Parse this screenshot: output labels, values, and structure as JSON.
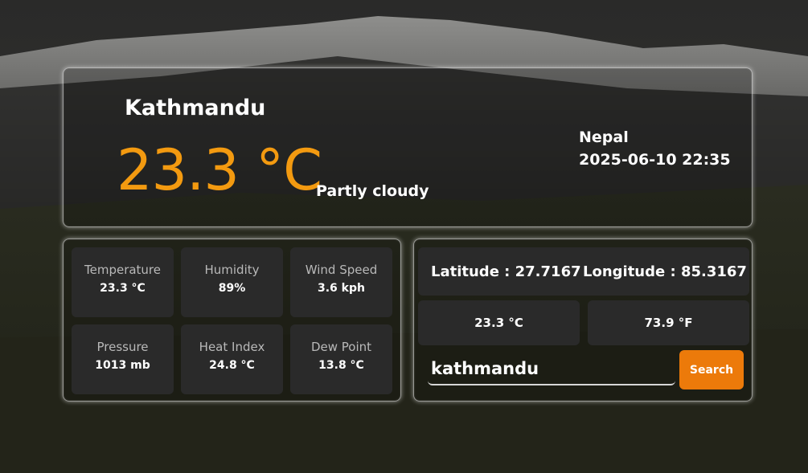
{
  "weather": {
    "city": "Kathmandu",
    "temperature": "23.3 °C",
    "condition": "Partly cloudy",
    "country": "Nepal",
    "datetime": "2025-06-10 22:35"
  },
  "stats": [
    {
      "label": "Temperature",
      "value": "23.3 °C"
    },
    {
      "label": "Humidity",
      "value": "89%"
    },
    {
      "label": "Wind Speed",
      "value": "3.6 kph"
    },
    {
      "label": "Pressure",
      "value": "1013 mb"
    },
    {
      "label": "Heat Index",
      "value": "24.8 °C"
    },
    {
      "label": "Dew Point",
      "value": "13.8 °C"
    }
  ],
  "geo": {
    "latitude": "Latitude : 27.7167",
    "longitude": "Longitude : 85.3167",
    "temp_c": "23.3 °C",
    "temp_f": "73.9 °F"
  },
  "search": {
    "value": "kathmandu",
    "button_label": "Search"
  },
  "colors": {
    "accent": "#f39a10",
    "button": "#ec7a0a",
    "tile": "#2a2a2a"
  }
}
